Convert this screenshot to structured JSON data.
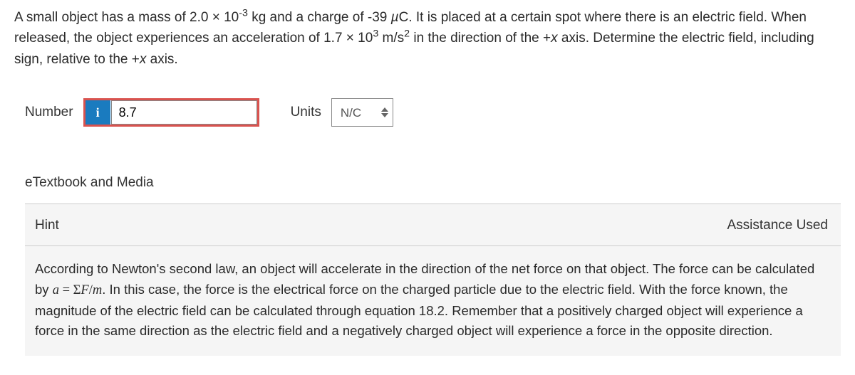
{
  "question": {
    "text_pre": "A small object has a mass of 2.0 × 10",
    "sup1": "-3",
    "text_mid1": " kg and a charge of -39 ",
    "mu": "µ",
    "text_mid2": "C. It is placed at a certain spot where there is an electric field. When released, the object experiences an acceleration of 1.7 × 10",
    "sup2": "3",
    "text_mid3": " m/s",
    "sup3": "2",
    "text_mid4": " in the direction of the +",
    "x1": "x",
    "text_mid5": " axis. Determine the electric field, including sign, relative to the +",
    "x2": "x",
    "text_end": " axis."
  },
  "answer": {
    "number_label": "Number",
    "info_badge": "i",
    "number_value": "8.7",
    "units_label": "Units",
    "units_value": "N/C"
  },
  "links": {
    "etextbook": "eTextbook and Media"
  },
  "hint": {
    "title": "Hint",
    "assistance": "Assistance Used",
    "body_pre": "According to Newton's second law, an object will accelerate in the direction of the net force on that object. The force can be calculated by ",
    "a": "a",
    "eq": " = ",
    "sigma": "Σ",
    "F": "F",
    "slash": "/",
    "m": "m",
    "body_post": ". In this case, the force is the electrical force on the charged particle due to the electric field. With the force known, the magnitude of the electric field can be calculated through equation 18.2. Remember that a positively charged object will experience a force in the same direction as the electric field and a negatively charged object will experience a force in the opposite direction."
  }
}
